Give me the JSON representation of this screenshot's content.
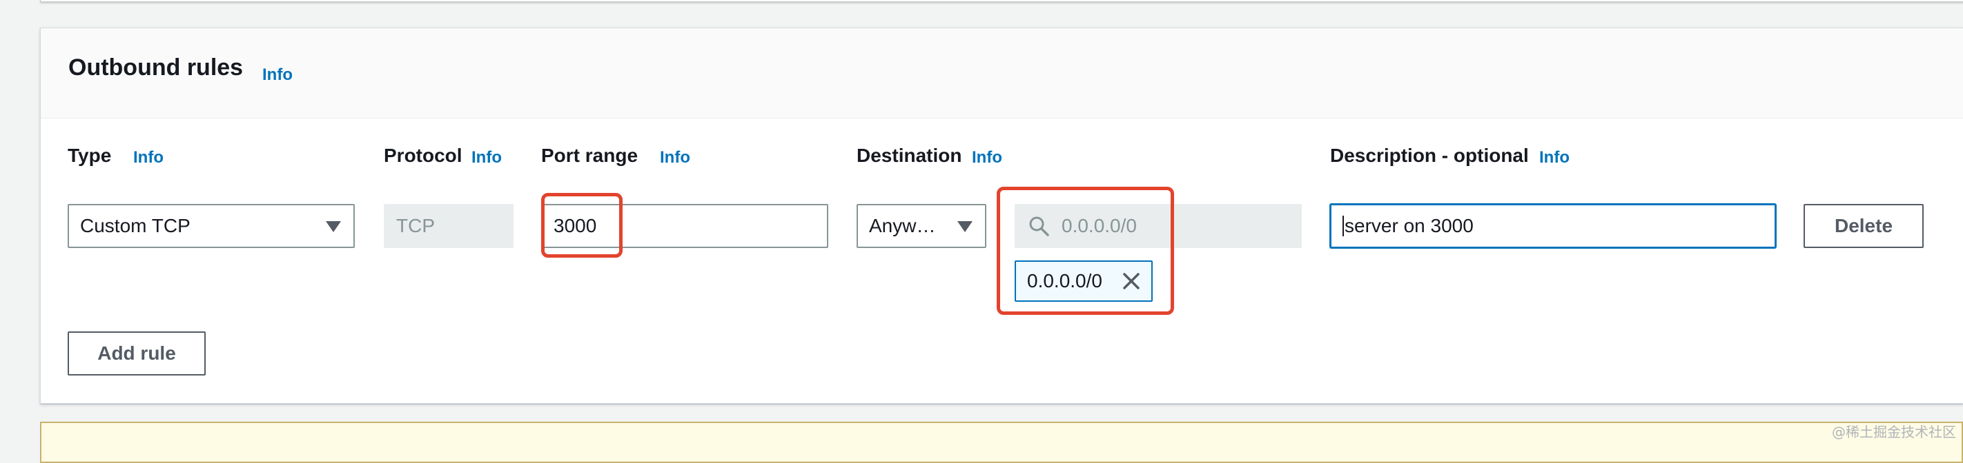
{
  "section": {
    "title": "Outbound rules",
    "info": "Info"
  },
  "columns": {
    "type": {
      "label": "Type",
      "info": "Info"
    },
    "protocol": {
      "label": "Protocol",
      "info": "Info"
    },
    "port_range": {
      "label": "Port range",
      "info": "Info"
    },
    "destination": {
      "label": "Destination",
      "info": "Info"
    },
    "description": {
      "label": "Description - optional",
      "info": "Info"
    }
  },
  "rule": {
    "type_value": "Custom TCP",
    "protocol_value": "TCP",
    "port_value": "3000",
    "destination_value": "Anyw…",
    "cidr_placeholder": "0.0.0.0/0",
    "cidr_token": "0.0.0.0/0",
    "description_value": "server on 3000"
  },
  "buttons": {
    "delete": "Delete",
    "add_rule": "Add rule"
  },
  "watermark": "@稀土掘金技术社区",
  "colors": {
    "accent": "#0073bb",
    "highlight": "#e3432d",
    "disabled_bg": "#eaeded"
  },
  "icons": {
    "dropdown": "caret-down-icon",
    "search": "search-icon",
    "remove": "close-icon"
  }
}
